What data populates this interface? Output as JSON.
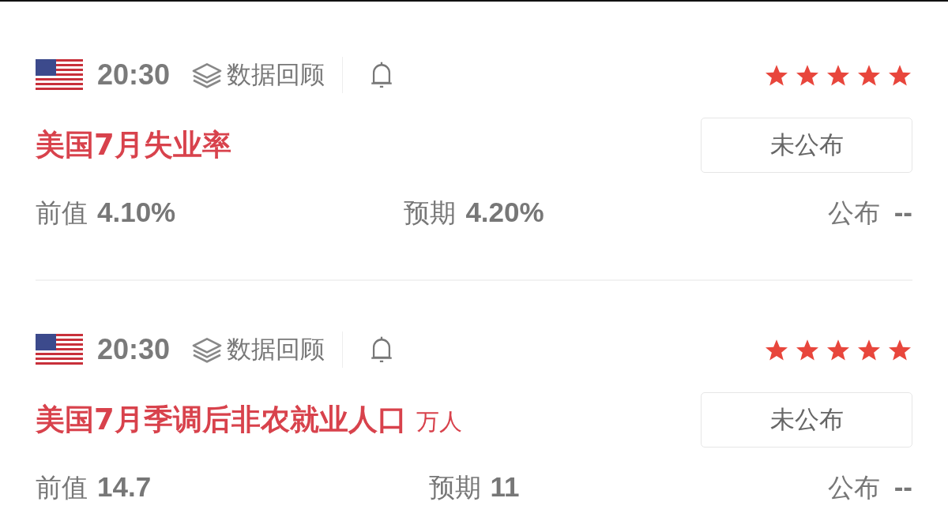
{
  "events": [
    {
      "time": "20:30",
      "review_label": "数据回顾",
      "stars": 5,
      "title": "美国7月失业率",
      "button": "未公布",
      "previous_label": "前值",
      "previous": "4.10%",
      "forecast_label": "预期",
      "forecast": "4.20%",
      "actual_label": "公布",
      "actual": "--"
    },
    {
      "time": "20:30",
      "review_label": "数据回顾",
      "stars": 5,
      "title": "美国7月季调后非农就业人口",
      "unit": "万人",
      "button": "未公布",
      "previous_label": "前值",
      "previous": "14.7",
      "forecast_label": "预期",
      "forecast": "11",
      "actual_label": "公布",
      "actual": "--"
    }
  ]
}
